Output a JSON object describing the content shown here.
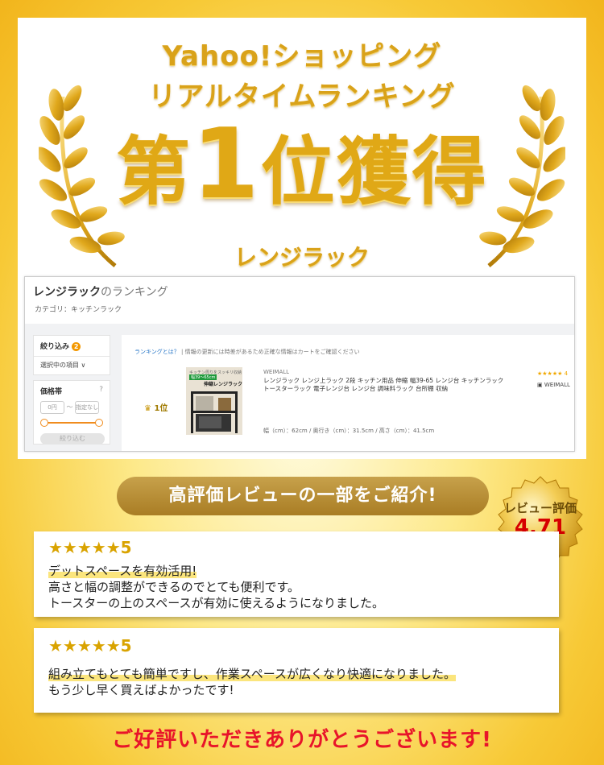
{
  "header": {
    "line1": "Yahoo!ショッピング",
    "line2": "リアルタイムランキング",
    "rank_prefix": "第",
    "rank_num": "1",
    "rank_suffix": "位獲得",
    "category": "レンジラック"
  },
  "ranking_screenshot": {
    "title_bold": "レンジラック",
    "title_rest": "のランキング",
    "category_label": "カテゴリ：キッチンラック",
    "filter_label": "絞り込み",
    "filter_count": "2",
    "filter_select": "選択中の項目 ∨",
    "price_label": "価格帯",
    "price_min": "0円",
    "price_tilde": "〜",
    "price_max": "指定なし",
    "narrow_button": "絞り込む",
    "note_link": "ランキングとは？",
    "note_text": "| 情報の更新には時差があるため正確な情報はカートをご確認ください",
    "rank_position": "1位",
    "thumb_top": "キッチン周りをスッキリ収納",
    "thumb_tag": "幅39〜65cm",
    "thumb_name": "伸縮レンジラック",
    "store": "WEIMALL",
    "product_name": "レンジラック レンジ上ラック 2段 キッチン用品 伸縮 幅39-65 レンジ台 キッチンラック トースターラック 電子レンジ台 レンジ台 調味料ラック 台所棚 収納",
    "product_size": "幅（cm）：62cm / 奥行き（cm）：31.5cm / 高さ（cm）：41.5cm",
    "product_stars": "★★★★★ 4",
    "seller": "WEIMALL"
  },
  "banner": {
    "text": "高評価レビューの一部をご紹介!"
  },
  "medal": {
    "label": "レビュー評価",
    "score": "4.71"
  },
  "reviews": [
    {
      "stars": "★★★★★5",
      "lines": [
        "デットスペースを有効活用!",
        "高さと幅の調整ができるのでとても便利です。",
        "トースターの上のスペースが有効に使えるようになりました。"
      ]
    },
    {
      "stars": "★★★★★5",
      "lines": [
        "組み立てもとても簡単ですし、作業スペースが広くなり快適になりました。",
        "もう少し早く買えばよかったです!"
      ]
    }
  ],
  "footer": {
    "thanks": "ご好評いただきありがとうございます!"
  },
  "colors": {
    "gold": "#d9a21a",
    "banner": "#b58a30",
    "red": "#e8142a"
  }
}
